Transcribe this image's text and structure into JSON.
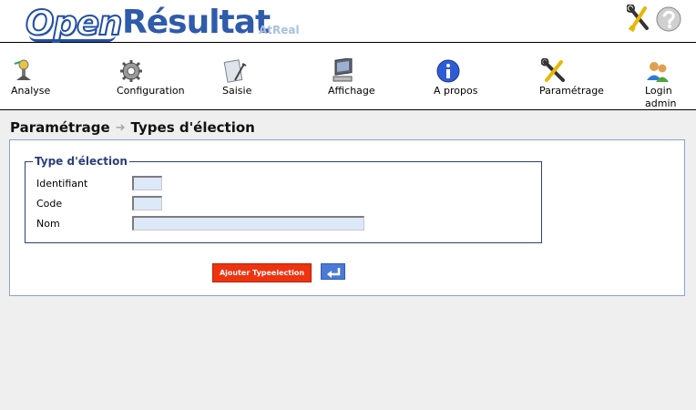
{
  "header": {
    "logo_open": "Open",
    "logo_resultat": "Résultat",
    "logo_atreal": "AtReal",
    "icons": [
      "tools-icon",
      "help-icon"
    ]
  },
  "toolbar": {
    "items": [
      {
        "label": "Analyse",
        "icon": "analyse-icon"
      },
      {
        "label": "Configuration",
        "icon": "gear-icon"
      },
      {
        "label": "Saisie",
        "icon": "pen-icon"
      },
      {
        "label": "Affichage",
        "icon": "monitor-icon"
      },
      {
        "label": "A propos",
        "icon": "info-icon"
      },
      {
        "label": "Paramétrage",
        "icon": "tools-icon"
      },
      {
        "label": "Login",
        "sublabel": "admin",
        "icon": "users-icon"
      }
    ]
  },
  "breadcrumb": {
    "parent": "Paramétrage",
    "current": "Types d'élection"
  },
  "form": {
    "legend": "Type d'élection",
    "fields": [
      {
        "label": "Identifiant",
        "value": ""
      },
      {
        "label": "Code",
        "value": ""
      },
      {
        "label": "Nom",
        "value": ""
      }
    ],
    "submit_label": "Ajouter Typeelection",
    "back_icon": "back-arrow-icon"
  },
  "colors": {
    "brand_blue": "#2f5bab",
    "submit_red": "#ee3311",
    "back_blue": "#4a7ad6",
    "input_bg": "#dde8f8"
  }
}
